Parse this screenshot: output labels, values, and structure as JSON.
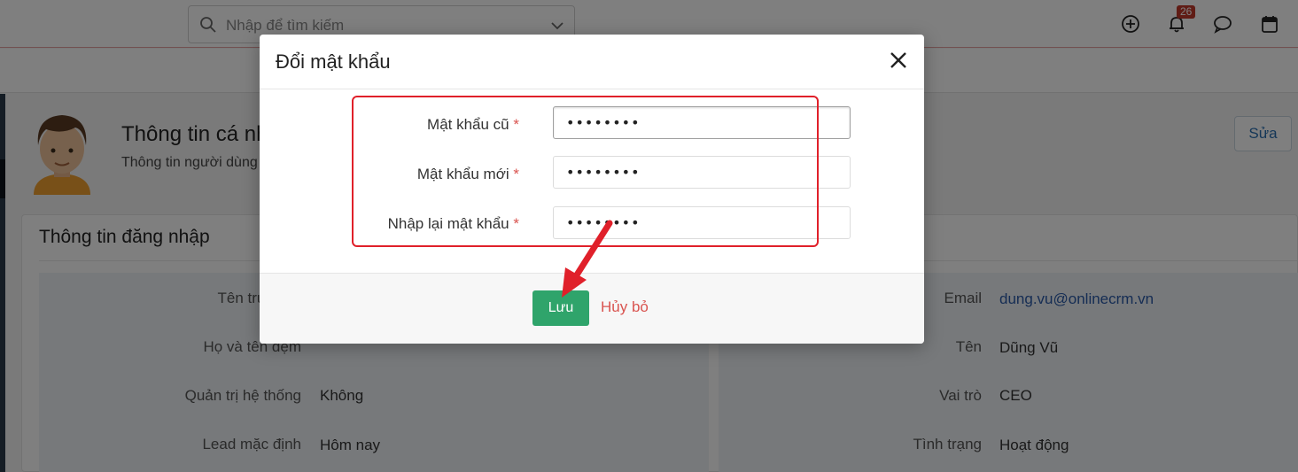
{
  "topbar": {
    "search_placeholder": "Nhập để tìm kiếm",
    "notification_count": "26"
  },
  "profile": {
    "title": "Thông tin cá nhân",
    "subtitle": "Thông tin người dùng",
    "edit_label": "Sửa"
  },
  "login_card": {
    "title": "Thông tin đăng nhập",
    "left_fields": [
      {
        "label": "Tên truy cập",
        "value": ""
      },
      {
        "label": "Họ và tên đệm",
        "value": ""
      },
      {
        "label": "Quản trị hệ thống",
        "value": "Không"
      },
      {
        "label": "Lead mặc định",
        "value": "Hôm nay"
      }
    ],
    "right_fields": [
      {
        "label": "Email",
        "value": "dung.vu@onlinecrm.vn"
      },
      {
        "label": "Tên",
        "value": "Dũng Vũ"
      },
      {
        "label": "Vai trò",
        "value": "CEO"
      },
      {
        "label": "Tình trạng",
        "value": "Hoạt động"
      }
    ]
  },
  "modal": {
    "title": "Đổi mật khẩu",
    "required_mark": "*",
    "fields": [
      {
        "label": "Mật khẩu cũ",
        "value": "••••••••"
      },
      {
        "label": "Mật khẩu mới",
        "value": "••••••••"
      },
      {
        "label": "Nhập lại mật khẩu",
        "value": "••••••••"
      }
    ],
    "save_label": "Lưu",
    "cancel_label": "Hủy bỏ"
  },
  "colors": {
    "accent_green": "#2fa46b",
    "highlight_red": "#e0202a",
    "cancel_red": "#d9534f",
    "link_blue": "#2a5aa8"
  }
}
